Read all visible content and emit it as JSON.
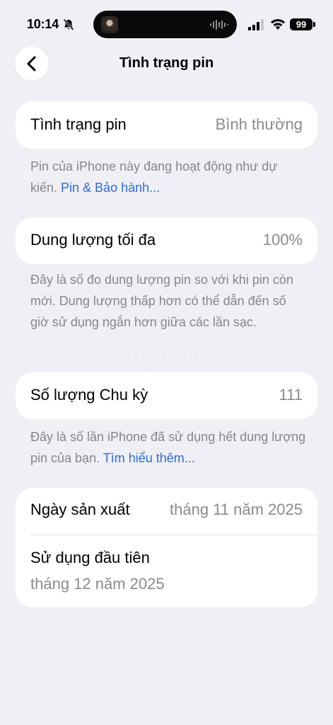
{
  "status_bar": {
    "time": "10:14",
    "battery": "99"
  },
  "nav": {
    "title": "Tình trạng pin"
  },
  "battery_health": {
    "label": "Tình trạng pin",
    "value": "Bình thường",
    "footer_text": "Pin của iPhone này đang hoạt động như dự kiến. ",
    "footer_link": "Pin & Bảo hành..."
  },
  "max_capacity": {
    "label": "Dung lượng tối đa",
    "value": "100%",
    "footer_text": "Đây là số đo dung lượng pin so với khi pin còn mới. Dung lượng thấp hơn có thể dẫn đến số giờ sử dụng ngắn hơn giữa các lần sạc."
  },
  "cycle_count": {
    "label": "Số lượng Chu kỳ",
    "value": "111",
    "footer_text": "Đây là số lần iPhone đã sử dụng hết dung lượng pin của bạn. ",
    "footer_link": "Tìm hiểu thêm..."
  },
  "dates": {
    "manufacture_label": "Ngày sản xuất",
    "manufacture_value": "tháng 11 năm 2025",
    "first_use_label": "Sử dụng đầu tiên",
    "first_use_value": "tháng 12 năm 2025"
  },
  "watermark": "chợTỐT",
  "colors": {
    "background": "#f0eff5",
    "link": "#2f6fd0",
    "secondary_text": "#86868b"
  }
}
